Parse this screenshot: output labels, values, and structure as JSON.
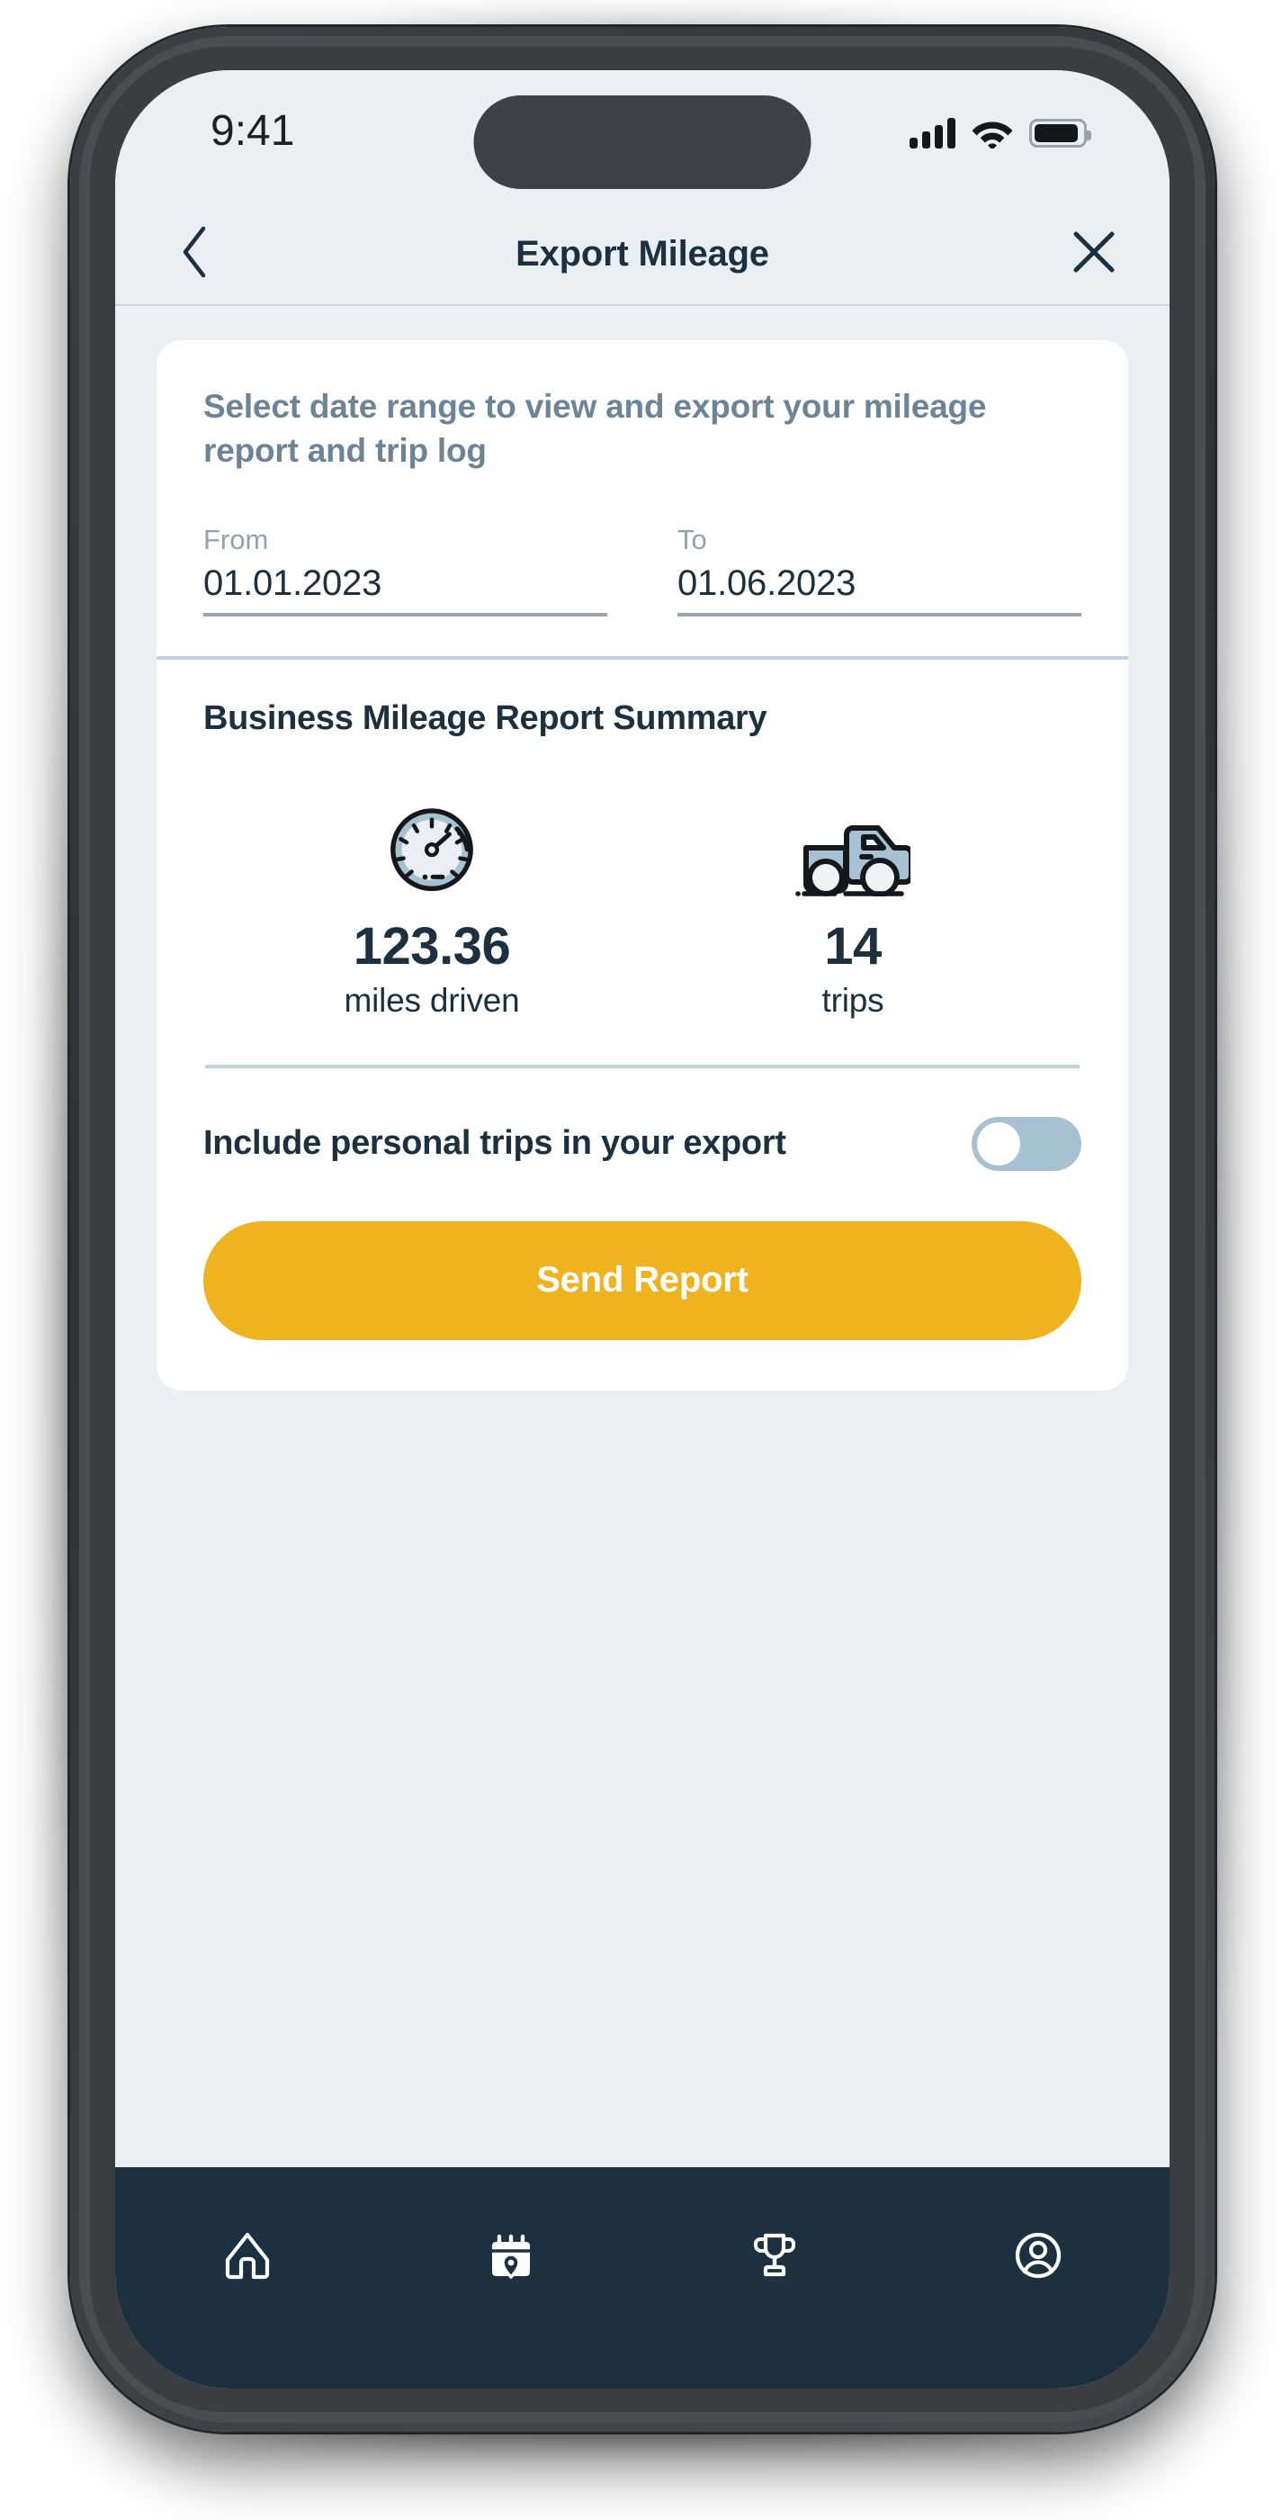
{
  "status_bar": {
    "time": "9:41",
    "signal_icon": "signal-bars-icon",
    "wifi_icon": "wifi-icon",
    "battery_icon": "battery-icon"
  },
  "header": {
    "title": "Export Mileage",
    "back_icon": "chevron-left-icon",
    "close_icon": "close-x-icon"
  },
  "intro": {
    "text": "Select date range to view and export your mileage report and trip log"
  },
  "date_range": {
    "from": {
      "label": "From",
      "value": "01.01.2023"
    },
    "to": {
      "label": "To",
      "value": "01.06.2023"
    }
  },
  "summary": {
    "title": "Business Mileage Report Summary",
    "stats": [
      {
        "icon": "speedometer-icon",
        "value": "123.36",
        "label": "miles driven"
      },
      {
        "icon": "pickup-truck-icon",
        "value": "14",
        "label": "trips"
      }
    ]
  },
  "personal_trips": {
    "label": "Include personal trips in your export",
    "toggle_state": "off"
  },
  "actions": {
    "send_report_label": "Send Report"
  },
  "bottom_nav": {
    "items": [
      {
        "icon": "home-icon",
        "name": "home"
      },
      {
        "icon": "calendar-location-icon",
        "name": "trips"
      },
      {
        "icon": "trophy-icon",
        "name": "rewards"
      },
      {
        "icon": "account-circle-icon",
        "name": "profile"
      }
    ]
  },
  "colors": {
    "page_background": "#eaeff3",
    "card_background": "#ffffff",
    "primary_text": "#1c3040",
    "muted_text": "#6c8496",
    "accent_button": "#efb31f",
    "nav_background": "#1c3040",
    "toggle_track": "#a8c1d2",
    "divider": "#c2d2dc",
    "icon_fill": "#a8c1d2"
  }
}
